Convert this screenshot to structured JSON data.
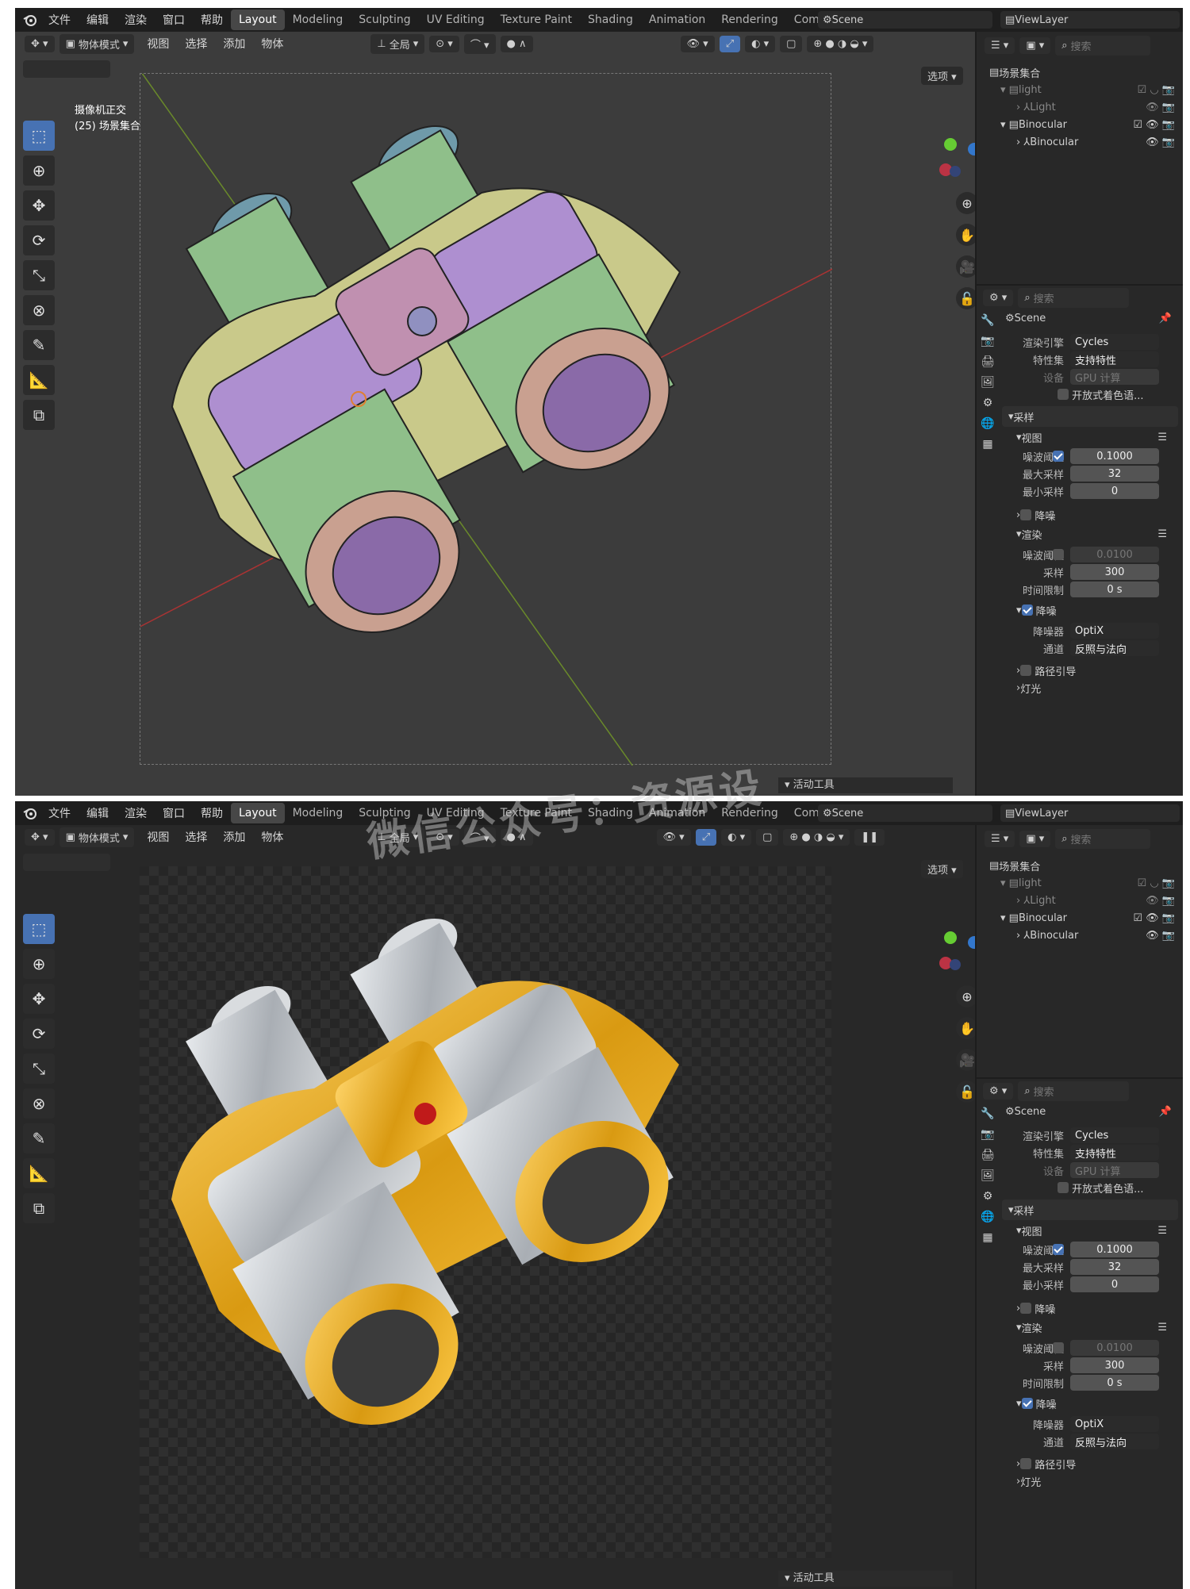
{
  "colors": {
    "accent": "#4772b3",
    "panel_bg": "#282828",
    "viewport_bg": "#3c3c3c",
    "checker_light": "#2f2f2f",
    "gold": "#e0a21b",
    "silver": "#bfc4c8"
  },
  "topbar": {
    "menus": [
      "文件",
      "编辑",
      "渲染",
      "窗口",
      "帮助"
    ],
    "workspaces": [
      "Layout",
      "Modeling",
      "Sculpting",
      "UV Editing",
      "Texture Paint",
      "Shading",
      "Animation",
      "Rendering",
      "Compositing"
    ],
    "scene": "Scene",
    "view_layer": "ViewLayer"
  },
  "viewport": {
    "mode": "物体模式",
    "menus": [
      "视图",
      "选择",
      "添加",
      "物体"
    ],
    "transform": "全局",
    "options": "选项",
    "camera_title": "摄像机正交",
    "camera_sub": "(25) 场景集合",
    "active_tool": "活动工具"
  },
  "outliner": {
    "search_placeholder": "搜索",
    "root": "场景集合",
    "rows": [
      "light",
      "Light",
      "Binocular",
      "Binocular"
    ]
  },
  "properties": {
    "search_placeholder": "搜索",
    "scene": "Scene",
    "render_engine_label": "渲染引擎",
    "render_engine": "Cycles",
    "feature_set_label": "特性集",
    "feature_set": "支持特性",
    "device_label": "设备",
    "device": "GPU 计算",
    "osl_label": "开放式着色语...",
    "sampling": "采样",
    "viewport": "视图",
    "noise_threshold_label": "噪波阈值",
    "noise_threshold": "0.1000",
    "max_samples_label": "最大采样",
    "max_samples": "32",
    "min_samples_label": "最小采样",
    "min_samples": "0",
    "denoise": "降噪",
    "render": "渲染",
    "render_noise_threshold": "0.0100",
    "samples_label": "采样",
    "samples": "300",
    "time_limit_label": "时间限制",
    "time_limit": "0 s",
    "denoiser_label": "降噪器",
    "denoiser": "OptiX",
    "passes_label": "通道",
    "passes": "反照与法向",
    "path_guiding": "路径引导",
    "lights": "灯光"
  },
  "watermark": "微信公众号：资源设"
}
